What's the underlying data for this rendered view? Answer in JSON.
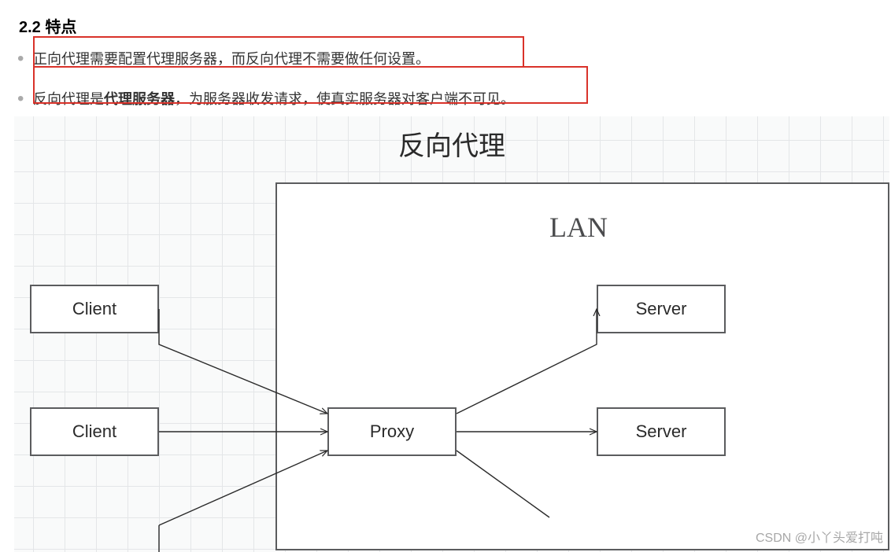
{
  "heading": "2.2 特点",
  "bullets": {
    "b1": "正向代理需要配置代理服务器，而反向代理不需要做任何设置。",
    "b2_prefix": "反向代理是",
    "b2_bold": "代理服务器",
    "b2_suffix": "，为服务器收发请求，使真实服务器对客户端不可见。"
  },
  "diagram": {
    "title": "反向代理",
    "lan_label": "LAN",
    "nodes": {
      "client1": "Client",
      "client2": "Client",
      "proxy": "Proxy",
      "server1": "Server",
      "server2": "Server"
    }
  },
  "watermark": "CSDN @小丫头爱打吨"
}
